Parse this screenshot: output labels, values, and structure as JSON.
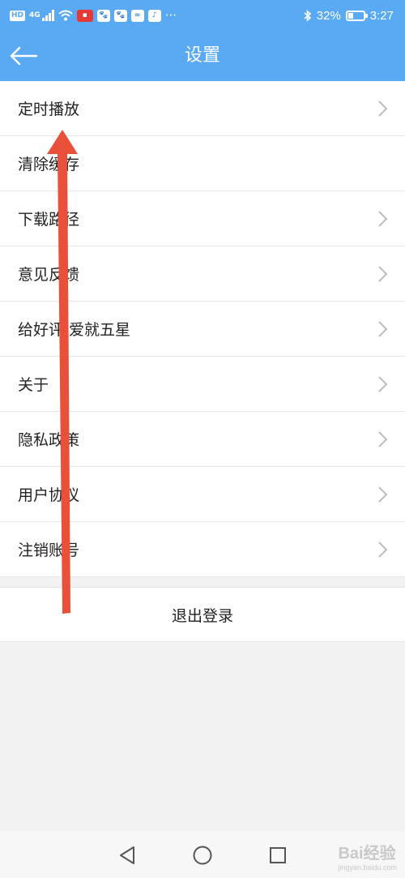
{
  "status_bar": {
    "hd": "HD",
    "network": "4G",
    "battery": "32%",
    "battery_level": 0.32,
    "time": "3:27",
    "more": "···"
  },
  "header": {
    "title": "设置"
  },
  "settings": {
    "items": [
      {
        "label": "定时播放",
        "has_chevron": true
      },
      {
        "label": "清除缓存",
        "has_chevron": false
      },
      {
        "label": "下载路径",
        "has_chevron": true
      },
      {
        "label": "意见反馈",
        "has_chevron": true
      },
      {
        "label": "给好评,爱就五星",
        "has_chevron": true
      },
      {
        "label": "关于",
        "has_chevron": true
      },
      {
        "label": "隐私政策",
        "has_chevron": true
      },
      {
        "label": "用户协议",
        "has_chevron": true
      },
      {
        "label": "注销账号",
        "has_chevron": true
      }
    ]
  },
  "logout": {
    "label": "退出登录"
  },
  "watermark": {
    "brand": "Bai经验",
    "url": "jingyan.baidu.com"
  },
  "colors": {
    "header_bg": "#59a9f3",
    "annotation_arrow": "#e8503a"
  },
  "icons": [
    "back-arrow-icon",
    "chevron-right-icon",
    "back-nav-icon",
    "home-nav-icon",
    "recents-nav-icon"
  ]
}
